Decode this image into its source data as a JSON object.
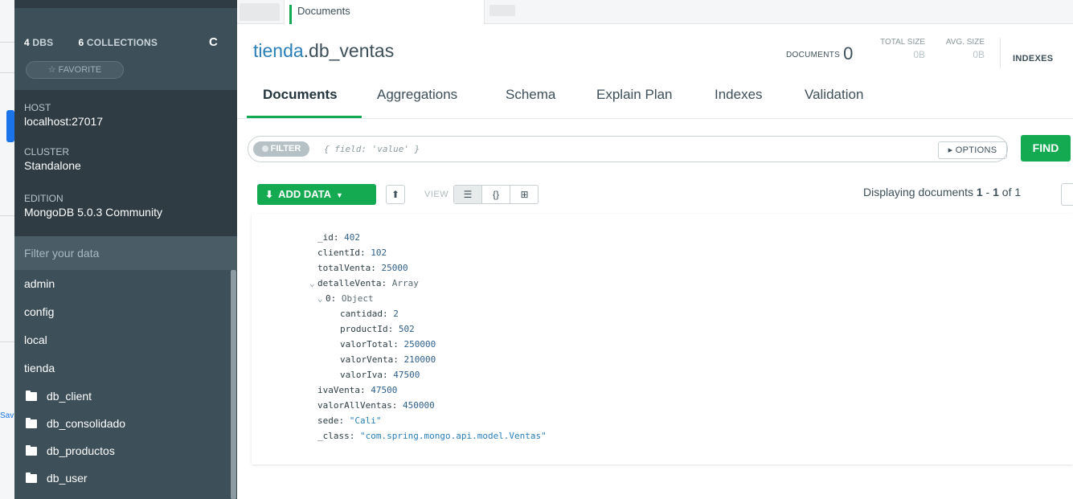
{
  "tab": {
    "label": "Documents"
  },
  "sidebar": {
    "dbs_count": "4",
    "dbs_label": "DBS",
    "collections_count": "6",
    "collections_label": "COLLECTIONS",
    "refresh_icon": "C",
    "favorite": "☆ FAVORITE",
    "host_label": "HOST",
    "host_value": "localhost:27017",
    "cluster_label": "CLUSTER",
    "cluster_value": "Standalone",
    "edition_label": "EDITION",
    "edition_value": "MongoDB 5.0.3 Community",
    "filter_placeholder": "Filter your data",
    "databases": [
      "admin",
      "config",
      "local",
      "tienda"
    ],
    "collections": [
      "db_client",
      "db_consolidado",
      "db_productos",
      "db_user"
    ]
  },
  "header": {
    "db": "tienda",
    "collection": ".db_ventas",
    "documents_label": "DOCUMENTS",
    "documents_value": "0",
    "total_size_label": "TOTAL SIZE",
    "total_size_value": "0B",
    "avg_size_label": "AVG. SIZE",
    "avg_size_value": "0B",
    "indexes_label": "INDEXES"
  },
  "subtabs": [
    "Documents",
    "Aggregations",
    "Schema",
    "Explain Plan",
    "Indexes",
    "Validation"
  ],
  "query": {
    "filter_label": "FILTER",
    "placeholder": "{ field: 'value' }",
    "options_label": "▸ OPTIONS",
    "find_label": "FIND"
  },
  "toolbar": {
    "add_data_label": "ADD DATA",
    "view_label": "VIEW",
    "display_prefix": "Displaying documents ",
    "display_from": "1",
    "display_sep": " - ",
    "display_to": "1",
    "display_of": " of 1"
  },
  "document": {
    "id_key": "_id",
    "id_val": "402",
    "client_key": "clientId",
    "client_val": "102",
    "total_key": "totalVenta",
    "total_val": "25000",
    "detalle_key": "detalleVenta",
    "detalle_type": "Array",
    "item_key": "0",
    "item_type": "Object",
    "cantidad_key": "cantidad",
    "cantidad_val": "2",
    "productId_key": "productId",
    "productId_val": "502",
    "valorTotal_key": "valorTotal",
    "valorTotal_val": "250000",
    "valorVenta_key": "valorVenta",
    "valorVenta_val": "210000",
    "valorIva_key": "valorIva",
    "valorIva_val": "47500",
    "ivaVenta_key": "ivaVenta",
    "ivaVenta_val": "47500",
    "valorAll_key": "valorAllVentas",
    "valorAll_val": "450000",
    "sede_key": "sede",
    "sede_val": "\"Cali\"",
    "class_key": "_class",
    "class_val": "\"com.spring.mongo.api.model.Ventas\""
  },
  "behind": {
    "text": "Sav"
  }
}
